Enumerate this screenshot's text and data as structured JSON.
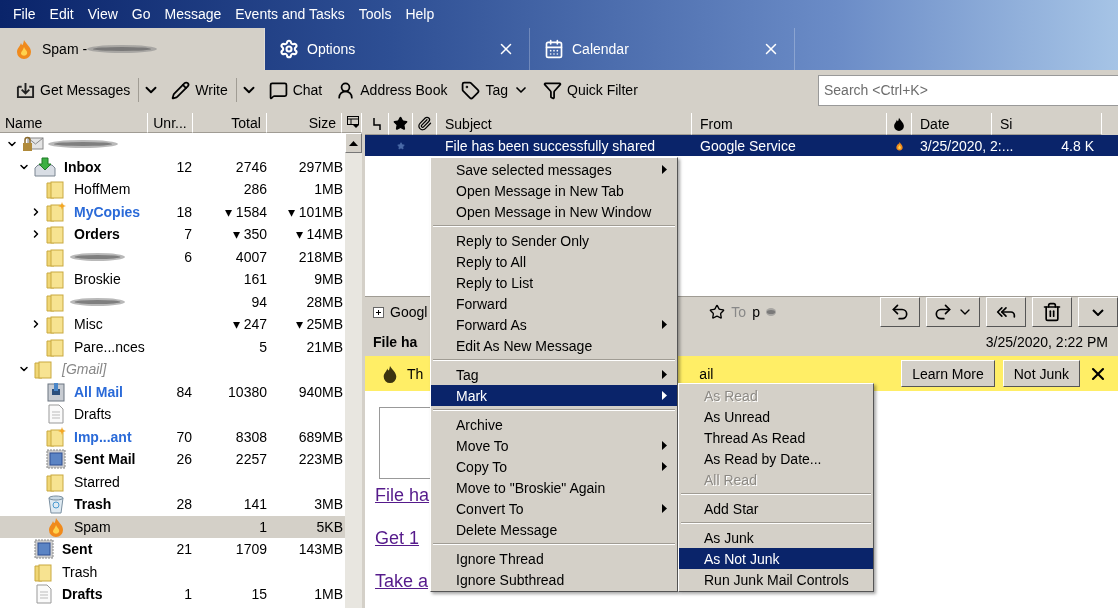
{
  "menubar": [
    "File",
    "Edit",
    "View",
    "Go",
    "Message",
    "Events and Tasks",
    "Tools",
    "Help"
  ],
  "tabs": [
    {
      "label": "Spam - ",
      "kind": "folder",
      "selected": true,
      "redacted": true,
      "closable": false
    },
    {
      "label": "Options",
      "kind": "settings",
      "selected": false,
      "redacted": false,
      "closable": true
    },
    {
      "label": "Calendar",
      "kind": "calendar",
      "selected": false,
      "redacted": false,
      "closable": true
    }
  ],
  "toolbar": {
    "buttons": [
      {
        "label": "Get Messages",
        "kind": "split"
      },
      {
        "label": "Write",
        "kind": "split"
      },
      {
        "label": "Chat",
        "kind": "plain"
      },
      {
        "label": "Address Book",
        "kind": "plain"
      },
      {
        "label": "Tag",
        "kind": "menu"
      },
      {
        "label": "Quick Filter",
        "kind": "plain"
      }
    ],
    "search": {
      "placeholder": "Search <Ctrl+K>"
    }
  },
  "folder_pane": {
    "columns": [
      "Name",
      "Unr...",
      "Total",
      "Size"
    ],
    "folders": [
      {
        "kind": "account",
        "redacted": true,
        "selected": false,
        "expanded": true,
        "children": [
          {
            "name": "Inbox",
            "kind": "inbox",
            "unread": "12",
            "total": "2746",
            "size": "297MB",
            "has_new": false,
            "selected": false,
            "expanded": true,
            "children": [
              {
                "name": "HoffMem",
                "kind": "folder",
                "total": "286",
                "size": "1MB",
                "has_new": false,
                "selected": false
              },
              {
                "name": "MyCopies",
                "kind": "special",
                "unread": "18",
                "total": "▾ 1584",
                "size": "▾ 101MB",
                "has_new": true,
                "selected": false,
                "expanded": false
              },
              {
                "name": "Orders",
                "kind": "folder",
                "unread": "7",
                "total": "▾ 350",
                "size": "▾ 14MB",
                "has_new": false,
                "selected": false,
                "expanded": false
              },
              {
                "kind": "folder",
                "redacted": true,
                "unread": "6",
                "total": "4007",
                "size": "218MB",
                "selected": false
              },
              {
                "name": "Broskie",
                "kind": "folder",
                "total": "161",
                "size": "9MB",
                "has_new": false,
                "selected": false
              },
              {
                "kind": "folder",
                "redacted": true,
                "total": "94",
                "size": "28MB",
                "selected": false
              },
              {
                "name": "Misc",
                "kind": "folder",
                "total": "▾ 247",
                "size": "▾ 25MB",
                "has_new": false,
                "selected": false,
                "expanded": false
              },
              {
                "name": "Pare...nces",
                "kind": "folder",
                "total": "5",
                "size": "21MB",
                "has_new": false,
                "selected": false
              }
            ]
          },
          {
            "name": "[Gmail]",
            "kind": "virtual",
            "has_new": false,
            "selected": false,
            "expanded": true,
            "children": [
              {
                "name": "All Mail",
                "kind": "archive",
                "unread": "84",
                "total": "10380",
                "size": "940MB",
                "has_new": true,
                "selected": false
              },
              {
                "name": "Drafts",
                "kind": "drafts",
                "has_new": false,
                "selected": false
              },
              {
                "name": "Imp...ant",
                "kind": "special",
                "unread": "70",
                "total": "8308",
                "size": "689MB",
                "has_new": true,
                "selected": false
              },
              {
                "name": "Sent Mail",
                "kind": "sent",
                "unread": "26",
                "total": "2257",
                "size": "223MB",
                "has_new": false,
                "selected": false
              },
              {
                "name": "Starred",
                "kind": "folder",
                "has_new": false,
                "selected": false
              },
              {
                "name": "Trash",
                "kind": "trash",
                "unread": "28",
                "total": "141",
                "size": "3MB",
                "has_new": false,
                "selected": false
              },
              {
                "name": "Spam",
                "kind": "junk",
                "total": "1",
                "size": "5KB",
                "has_new": false,
                "selected": true
              }
            ]
          },
          {
            "name": "Sent",
            "kind": "sent",
            "unread": "21",
            "total": "1709",
            "size": "143MB",
            "has_new": false,
            "selected": false
          },
          {
            "name": "Trash",
            "kind": "folder",
            "has_new": false,
            "selected": false
          },
          {
            "name": "Drafts",
            "kind": "drafts",
            "unread": "1",
            "total": "15",
            "size": "1MB",
            "has_new": false,
            "selected": false
          }
        ]
      }
    ]
  },
  "message_list": {
    "columns": [
      {
        "kind": "thread"
      },
      {
        "kind": "star"
      },
      {
        "kind": "attachment"
      },
      {
        "kind": "text",
        "label": "Subject"
      },
      {
        "kind": "text",
        "label": "From"
      },
      {
        "kind": "junk"
      },
      {
        "kind": "text",
        "label": "Date"
      },
      {
        "kind": "text",
        "label": "Si"
      }
    ],
    "rows": [
      {
        "subject": "File has been successfully shared",
        "from": "Google Service",
        "date": "3/25/2020, 2:...",
        "size": "4.8 K",
        "starred": false,
        "junk": true,
        "selected": true
      }
    ]
  },
  "message_header": {
    "from": "Googl",
    "starred": false,
    "to_label": "To",
    "to": "p",
    "to_redacted": true,
    "subject": "File ha",
    "date": "3/25/2020, 2:22 PM",
    "buttons": [
      {
        "kind": "reply"
      },
      {
        "kind": "forward"
      },
      {
        "kind": "reply-all"
      },
      {
        "kind": "delete"
      },
      {
        "kind": "more"
      }
    ]
  },
  "junk_bar": {
    "text_start": "Th",
    "text_end": "ail",
    "buttons": [
      "Learn More",
      "Not Junk"
    ]
  },
  "body": {
    "links": [
      "File ha",
      "Get 1",
      "Take a"
    ]
  },
  "context_menu": [
    {
      "kind": "item",
      "label": "Save selected messages",
      "submenu": true,
      "disabled": false,
      "selected": false
    },
    {
      "kind": "item",
      "label": "Open Message in New Tab",
      "submenu": false,
      "disabled": false,
      "selected": false
    },
    {
      "kind": "item",
      "label": "Open Message in New Window",
      "submenu": false,
      "disabled": false,
      "selected": false
    },
    {
      "kind": "separator"
    },
    {
      "kind": "item",
      "label": "Reply to Sender Only",
      "submenu": false,
      "disabled": false,
      "selected": false
    },
    {
      "kind": "item",
      "label": "Reply to All",
      "submenu": false,
      "disabled": false,
      "selected": false
    },
    {
      "kind": "item",
      "label": "Reply to List",
      "submenu": false,
      "disabled": false,
      "selected": false
    },
    {
      "kind": "item",
      "label": "Forward",
      "submenu": false,
      "disabled": false,
      "selected": false
    },
    {
      "kind": "item",
      "label": "Forward As",
      "submenu": true,
      "disabled": false,
      "selected": false
    },
    {
      "kind": "item",
      "label": "Edit As New Message",
      "submenu": false,
      "disabled": false,
      "selected": false
    },
    {
      "kind": "separator"
    },
    {
      "kind": "item",
      "label": "Tag",
      "submenu": true,
      "disabled": false,
      "selected": false
    },
    {
      "kind": "item",
      "label": "Mark",
      "submenu": true,
      "disabled": false,
      "selected": true
    },
    {
      "kind": "separator"
    },
    {
      "kind": "item",
      "label": "Archive",
      "submenu": false,
      "disabled": false,
      "selected": false
    },
    {
      "kind": "item",
      "label": "Move To",
      "submenu": true,
      "disabled": false,
      "selected": false
    },
    {
      "kind": "item",
      "label": "Copy To",
      "submenu": true,
      "disabled": false,
      "selected": false
    },
    {
      "kind": "item",
      "label": "Move to \"Broskie\" Again",
      "submenu": false,
      "disabled": false,
      "selected": false
    },
    {
      "kind": "item",
      "label": "Convert To",
      "submenu": true,
      "disabled": false,
      "selected": false
    },
    {
      "kind": "item",
      "label": "Delete Message",
      "submenu": false,
      "disabled": false,
      "selected": false
    },
    {
      "kind": "separator"
    },
    {
      "kind": "item",
      "label": "Ignore Thread",
      "submenu": false,
      "disabled": false,
      "selected": false
    },
    {
      "kind": "item",
      "label": "Ignore Subthread",
      "submenu": false,
      "disabled": false,
      "selected": false
    }
  ],
  "mark_submenu": [
    {
      "kind": "item",
      "label": "As Read",
      "submenu": false,
      "disabled": true,
      "selected": false
    },
    {
      "kind": "item",
      "label": "As Unread",
      "submenu": false,
      "disabled": false,
      "selected": false
    },
    {
      "kind": "item",
      "label": "Thread As Read",
      "submenu": false,
      "disabled": false,
      "selected": false
    },
    {
      "kind": "item",
      "label": "As Read by Date...",
      "submenu": false,
      "disabled": false,
      "selected": false
    },
    {
      "kind": "item",
      "label": "All Read",
      "submenu": false,
      "disabled": true,
      "selected": false
    },
    {
      "kind": "separator"
    },
    {
      "kind": "item",
      "label": "Add Star",
      "submenu": false,
      "disabled": false,
      "selected": false
    },
    {
      "kind": "separator"
    },
    {
      "kind": "item",
      "label": "As Junk",
      "submenu": false,
      "disabled": false,
      "selected": false
    },
    {
      "kind": "item",
      "label": "As Not Junk",
      "submenu": false,
      "disabled": false,
      "selected": true
    },
    {
      "kind": "item",
      "label": "Run Junk Mail Controls",
      "submenu": false,
      "disabled": false,
      "selected": false
    }
  ]
}
